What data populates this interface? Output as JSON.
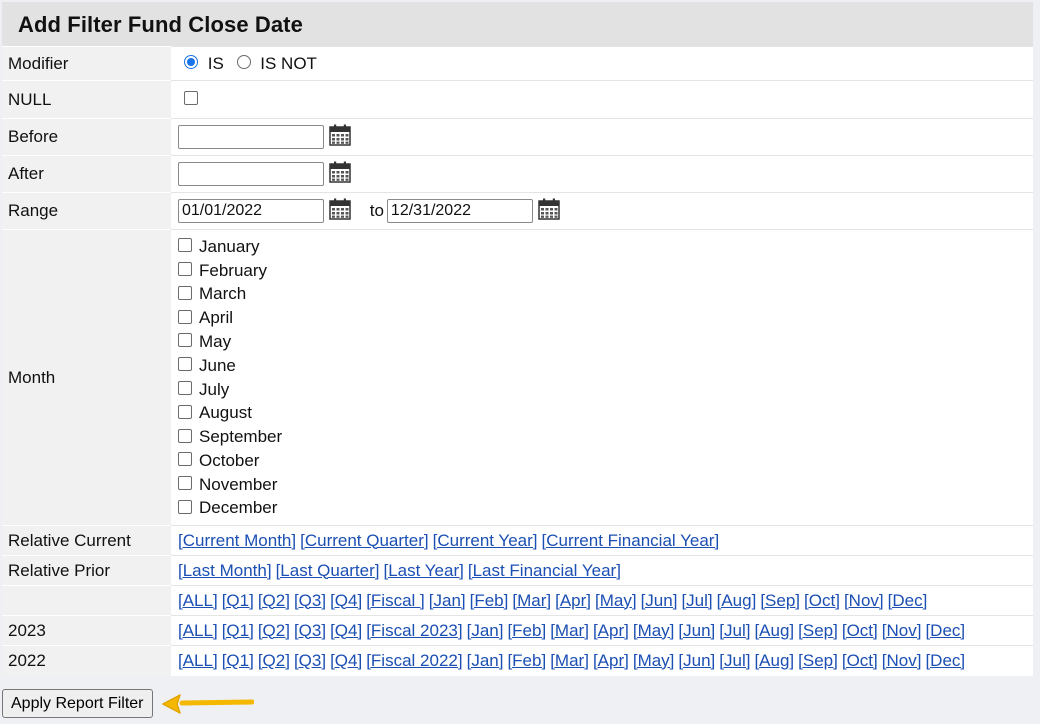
{
  "title": "Add Filter Fund Close Date",
  "modifier": {
    "label": "Modifier",
    "options": [
      "IS",
      "IS NOT"
    ],
    "selected": "IS"
  },
  "null_row": {
    "label": "NULL",
    "checked": false
  },
  "before": {
    "label": "Before",
    "value": ""
  },
  "after": {
    "label": "After",
    "value": ""
  },
  "range": {
    "label": "Range",
    "from": "01/01/2022",
    "to_label": "to",
    "to": "12/31/2022"
  },
  "month": {
    "label": "Month",
    "options": [
      "January",
      "February",
      "March",
      "April",
      "May",
      "June",
      "July",
      "August",
      "September",
      "October",
      "November",
      "December"
    ]
  },
  "relative_current": {
    "label": "Relative Current",
    "links": [
      "[Current Month]",
      "[Current Quarter]",
      "[Current Year]",
      "[Current Financial Year]"
    ]
  },
  "relative_prior": {
    "label": "Relative Prior",
    "links": [
      "[Last Month]",
      "[Last Quarter]",
      "[Last Year]",
      "[Last Financial Year]"
    ]
  },
  "period_rows": [
    {
      "label": "",
      "links": [
        "[ALL]",
        "[Q1]",
        "[Q2]",
        "[Q3]",
        "[Q4]",
        "[Fiscal ]",
        "[Jan]",
        "[Feb]",
        "[Mar]",
        "[Apr]",
        "[May]",
        "[Jun]",
        "[Jul]",
        "[Aug]",
        "[Sep]",
        "[Oct]",
        "[Nov]",
        "[Dec]"
      ]
    },
    {
      "label": "2023",
      "links": [
        "[ALL]",
        "[Q1]",
        "[Q2]",
        "[Q3]",
        "[Q4]",
        "[Fiscal 2023]",
        "[Jan]",
        "[Feb]",
        "[Mar]",
        "[Apr]",
        "[May]",
        "[Jun]",
        "[Jul]",
        "[Aug]",
        "[Sep]",
        "[Oct]",
        "[Nov]",
        "[Dec]"
      ]
    },
    {
      "label": "2022",
      "links": [
        "[ALL]",
        "[Q1]",
        "[Q2]",
        "[Q3]",
        "[Q4]",
        "[Fiscal 2022]",
        "[Jan]",
        "[Feb]",
        "[Mar]",
        "[Apr]",
        "[May]",
        "[Jun]",
        "[Jul]",
        "[Aug]",
        "[Sep]",
        "[Oct]",
        "[Nov]",
        "[Dec]"
      ]
    }
  ],
  "apply_button": "Apply Report Filter",
  "icons": {
    "calendar": "calendar-icon",
    "arrow": "arrow-left-icon"
  },
  "colors": {
    "link": "#1b4fb3",
    "header_bg": "#e2e2e2",
    "label_bg": "#f1f1f1",
    "arrow": "#f5b800",
    "radio": "#1a73e8"
  }
}
